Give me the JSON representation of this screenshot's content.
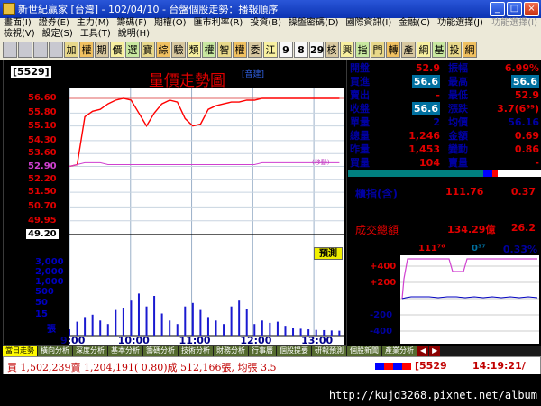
{
  "titlebar": {
    "title": "新世紀贏家 [台灣] - 102/04/10 - 台盤個股走勢：播報順序",
    "min": "_",
    "max": "□",
    "close": "×"
  },
  "menu": {
    "row1": [
      "畫面(I)",
      "證券(E)",
      "主力(M)",
      "籌碼(F)",
      "期權(O)",
      "匯市利率(R)",
      "投資(B)",
      "操盤密碼(D)",
      "國際資訊(I)",
      "金融(C)",
      "功能選擇(J)",
      "功能選擇(I)"
    ],
    "row2": [
      "檢視(V)",
      "設定(S)",
      "工具(T)",
      "說明(H)"
    ]
  },
  "toolbar": {
    "buttons": [
      "加",
      "權",
      "期",
      "價",
      "選",
      "寶",
      "綜",
      "驗",
      "類",
      "權",
      "智",
      "權",
      "委",
      "江",
      "9",
      "8",
      "29",
      "核",
      "興",
      "指",
      "門",
      "轉",
      "產",
      "綱",
      "基",
      "投",
      "網"
    ]
  },
  "chart": {
    "stock_code": "[5529]",
    "stock_name": "志嘉",
    "title": "量價走勢圖",
    "hint": "[音建]",
    "price_labels": [
      "56.60",
      "55.80",
      "55.10",
      "54.30",
      "53.60",
      "52.90",
      "52.20",
      "51.50",
      "50.70",
      "49.95",
      "49.20"
    ],
    "volume_labels": [
      "3,000",
      "2,000",
      "1,000",
      "500",
      "50",
      "15",
      "張"
    ],
    "time_labels": [
      "9:00",
      "10:00",
      "11:00",
      "12:00",
      "13:00"
    ],
    "ma_label": "(移動)",
    "predict_button": "預測"
  },
  "chart_data": {
    "type": "line",
    "title": "量價走勢圖",
    "x_range": [
      "09:00",
      "13:30"
    ],
    "ylim": [
      49.2,
      56.6
    ],
    "reference_price": 52.9,
    "series": [
      {
        "values": [
          52.9,
          53.0,
          55.6,
          55.9,
          56.0,
          56.3,
          56.5,
          56.6,
          56.5,
          55.8,
          55.1,
          55.8,
          56.3,
          56.5,
          56.4,
          55.5,
          55.1,
          55.2,
          56.0,
          56.2,
          56.3,
          56.4,
          56.4,
          56.5,
          56.5,
          56.6,
          56.6,
          56.6,
          56.6,
          56.6,
          56.6,
          56.6,
          56.6,
          56.6,
          56.6,
          56.6
        ]
      },
      {
        "values": [
          52.9,
          53.0,
          53.1,
          53.1,
          53.1,
          53.0,
          53.0,
          53.0,
          53.0,
          53.0,
          53.0,
          53.0,
          53.0,
          53.0,
          53.0,
          53.0,
          53.0,
          53.0,
          53.0,
          53.0,
          53.0,
          53.0,
          53.0,
          53.0,
          53.0,
          53.1,
          53.1,
          53.1,
          53.1,
          53.1,
          53.1,
          53.1,
          53.1,
          53.1,
          53.1,
          53.1
        ]
      }
    ],
    "volume": [
      15,
      80,
      120,
      140,
      90,
      60,
      180,
      200,
      260,
      320,
      210,
      300,
      150,
      90,
      60,
      210,
      240,
      180,
      120,
      90,
      60,
      210,
      260,
      190,
      60,
      90,
      70,
      80,
      45,
      30,
      20,
      15,
      10,
      8,
      5,
      3
    ],
    "volume_ylim": [
      0,
      600
    ]
  },
  "quote": {
    "rows": [
      {
        "k1": "開盤",
        "v1": "52.9",
        "k2": "振幅",
        "v2": "6.99%",
        "c1": "#e00000",
        "c2": "#e00000"
      },
      {
        "k1": "買進",
        "v1": "56.6",
        "k2": "最高",
        "v2": "56.6",
        "c1": "box",
        "c2": "box"
      },
      {
        "k1": "賣出",
        "v1": "-",
        "k2": "最低",
        "v2": "52.9",
        "c1": "#e00000",
        "c2": "#e00000"
      },
      {
        "k1": "收盤",
        "v1": "56.6",
        "k2": "漲跌",
        "v2": "3.7(6⁹⁹)",
        "c1": "box",
        "c2": "#e00000"
      },
      {
        "k1": "單量",
        "v1": "2",
        "k2": "均價",
        "v2": "56.16",
        "c1": "#0000a0",
        "c2": "#0000a0"
      },
      {
        "k1": "總量",
        "v1": "1,246",
        "k2": "金額",
        "v2": "0.69",
        "c1": "#e00000",
        "c2": "#e00000"
      },
      {
        "k1": "昨量",
        "v1": "1,453",
        "k2": "變動",
        "v2": "0.86",
        "c1": "#e00000",
        "c2": "#e00000"
      },
      {
        "k1": "買量",
        "v1": "104",
        "k2": "賣量",
        "v2": "-",
        "c1": "#e00000",
        "c2": "#e00000"
      }
    ]
  },
  "index": {
    "label": "櫃指(含)",
    "value": "111.76",
    "change": "0.37",
    "turnover_label": "成交總額",
    "turnover_value": "134.29億",
    "turnover_change": "26.2"
  },
  "mini": {
    "title": "櫃指",
    "value": "111⁷⁶",
    "change": "0³⁷",
    "pct": "0.33%",
    "y_labels": [
      "+400",
      "+200",
      "111³⁹",
      "-200",
      "-400"
    ]
  },
  "tabs": [
    "當日走勢",
    "橫向分析",
    "深度分析",
    "基本分析",
    "籌碼分析",
    "技術分析",
    "財務分析",
    "行事曆",
    "個股提要",
    "研報預測",
    "個股新聞",
    "產業分析"
  ],
  "status": {
    "text": "買 1,502,239賣 1,204,191( 0.80)成 512,166張, 均張 3.5",
    "code": "[5529",
    "time": "14:19:21/"
  },
  "footer": {
    "watermark": "http://kujd3268.pixnet.net/album"
  }
}
